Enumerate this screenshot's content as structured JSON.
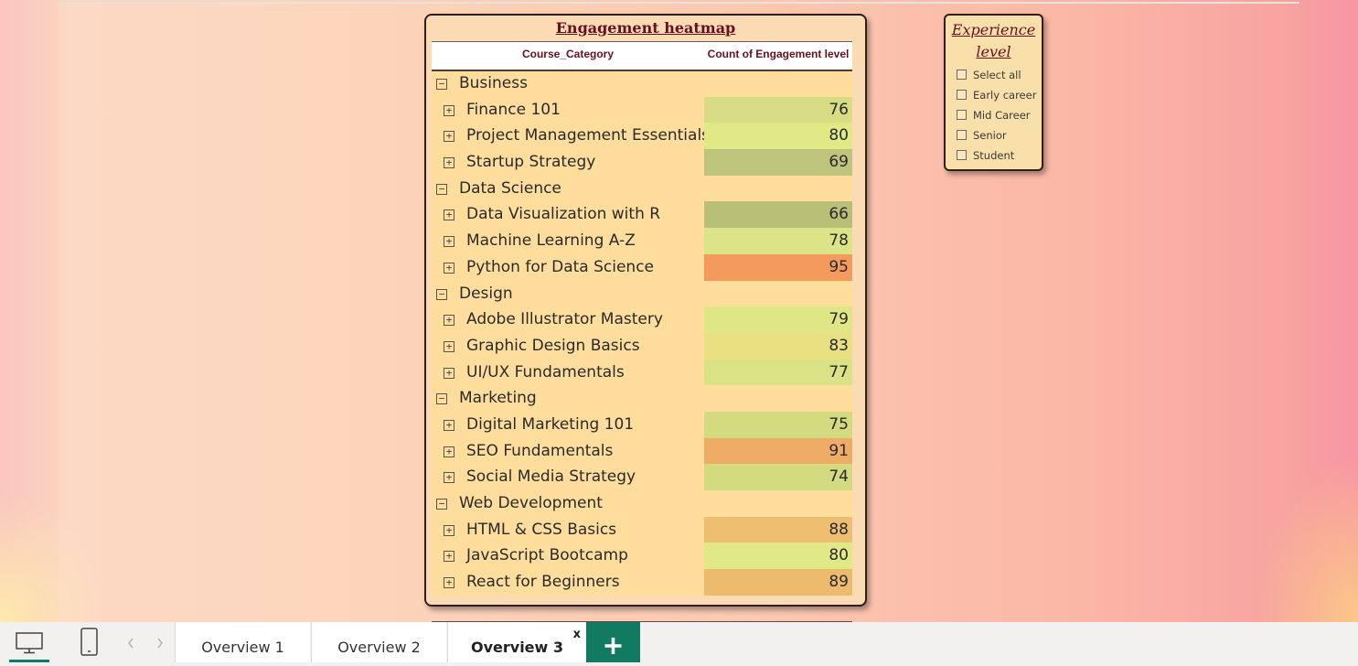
{
  "heatmap": {
    "title": "Engagement heatmap",
    "col_category": "Course_Category",
    "col_value": "Count of Engagement level",
    "rows": [
      {
        "type": "cat",
        "label": "Business",
        "value": "",
        "color": ""
      },
      {
        "type": "sub",
        "label": "Finance 101",
        "value": "76",
        "color": "#d8dc84"
      },
      {
        "type": "sub",
        "label": "Project Management Essentials",
        "value": "80",
        "color": "#e1e987"
      },
      {
        "type": "sub",
        "label": "Startup Strategy",
        "value": "69",
        "color": "#bdc57d"
      },
      {
        "type": "cat",
        "label": "Data Science",
        "value": "",
        "color": ""
      },
      {
        "type": "sub",
        "label": "Data Visualization with R",
        "value": "66",
        "color": "#b8c077"
      },
      {
        "type": "sub",
        "label": "Machine Learning A-Z",
        "value": "78",
        "color": "#dde487"
      },
      {
        "type": "sub",
        "label": "Python for Data Science",
        "value": "95",
        "color": "#f39a5c"
      },
      {
        "type": "cat",
        "label": "Design",
        "value": "",
        "color": ""
      },
      {
        "type": "sub",
        "label": "Adobe Illustrator Mastery",
        "value": "79",
        "color": "#dfe686"
      },
      {
        "type": "sub",
        "label": "Graphic Design Basics",
        "value": "83",
        "color": "#e8e081"
      },
      {
        "type": "sub",
        "label": "UI/UX Fundamentals",
        "value": "77",
        "color": "#dae286"
      },
      {
        "type": "cat",
        "label": "Marketing",
        "value": "",
        "color": ""
      },
      {
        "type": "sub",
        "label": "Digital Marketing 101",
        "value": "75",
        "color": "#d3da80"
      },
      {
        "type": "sub",
        "label": "SEO Fundamentals",
        "value": "91",
        "color": "#efac66"
      },
      {
        "type": "sub",
        "label": "Social Media Strategy",
        "value": "74",
        "color": "#d3da80"
      },
      {
        "type": "cat",
        "label": "Web Development",
        "value": "",
        "color": ""
      },
      {
        "type": "sub",
        "label": "HTML & CSS Basics",
        "value": "88",
        "color": "#edbe70"
      },
      {
        "type": "sub",
        "label": "JavaScript Bootcamp",
        "value": "80",
        "color": "#e1e987"
      },
      {
        "type": "sub",
        "label": "React for Beginners",
        "value": "89",
        "color": "#ecbb6e"
      }
    ]
  },
  "slicer": {
    "title_line1": "Experience",
    "title_line2": "level",
    "items": [
      "Select all",
      "Early career",
      "Mid Career",
      "Senior",
      "Student"
    ]
  },
  "tabs": {
    "items": [
      {
        "label": "Overview 1",
        "active": false
      },
      {
        "label": "Overview 2",
        "active": false
      },
      {
        "label": "Overview 3",
        "active": true
      }
    ],
    "close_glyph": "x",
    "add_glyph": "+"
  },
  "icons": {
    "desktop": "desktop-view-icon",
    "phone": "phone-view-icon",
    "prev": "chevron-left-icon",
    "next": "chevron-right-icon",
    "expand": "expand-icon",
    "collapse": "collapse-icon"
  },
  "colors": {
    "title": "#6b0f1e",
    "accent": "#137a62"
  }
}
